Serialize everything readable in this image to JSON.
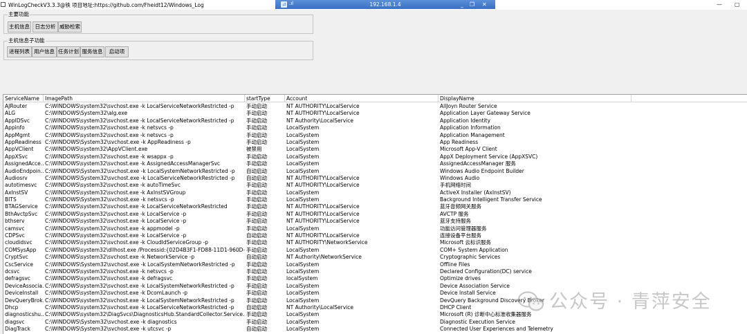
{
  "window": {
    "title": "WinLogCheckV3.3.3@铁 项目地址:https://github.com/Fheidt12/Windows_Log",
    "minimize": "—",
    "maximize": "▢"
  },
  "remote": {
    "pin": "⊿",
    "signal": ".ıl",
    "ip": "192.168.1.4",
    "minimize": "_",
    "restore": "❐",
    "close": "✕"
  },
  "main_functions": {
    "legend": "主要功能",
    "buttons": [
      "主机信息",
      "日志分析",
      "威胁检索"
    ]
  },
  "host_sub_functions": {
    "legend": "主机信息子功能",
    "buttons": [
      "进程列表",
      "用户信息",
      "任务计划",
      "服务信息",
      "启动项"
    ]
  },
  "table": {
    "columns": [
      "ServiceName",
      "ImagePath",
      "startType",
      "Account",
      "DisplayName"
    ],
    "rows": [
      [
        "AJRouter",
        "C:\\WINDOWS\\system32\\svchost.exe -k LocalServiceNetworkRestricted -p",
        "手动启动",
        "NT AUTHORITY\\LocalService",
        "AllJoyn Router Service"
      ],
      [
        "ALG",
        "C:\\WINDOWS\\System32\\alg.exe",
        "手动启动",
        "NT AUTHORITY\\LocalService",
        "Application Layer Gateway Service"
      ],
      [
        "AppIDSvc",
        "C:\\WINDOWS\\system32\\svchost.exe -k LocalServiceNetworkRestricted -p",
        "手动启动",
        "NT Authority\\LocalService",
        "Application Identity"
      ],
      [
        "Appinfo",
        "C:\\WINDOWS\\system32\\svchost.exe -k netsvcs -p",
        "手动启动",
        "LocalSystem",
        "Application Information"
      ],
      [
        "AppMgmt",
        "C:\\WINDOWS\\system32\\svchost.exe -k netsvcs -p",
        "手动启动",
        "LocalSystem",
        "Application Management"
      ],
      [
        "AppReadiness",
        "C:\\WINDOWS\\System32\\svchost.exe -k AppReadiness -p",
        "手动启动",
        "LocalSystem",
        "App Readiness"
      ],
      [
        "AppVClient",
        "C:\\WINDOWS\\system32\\AppVClient.exe",
        "被禁用",
        "LocalSystem",
        "Microsoft App-V Client"
      ],
      [
        "AppXSvc",
        "C:\\WINDOWS\\system32\\svchost.exe -k wsappx -p",
        "手动启动",
        "LocalSystem",
        "AppX Deployment Service (AppXSVC)"
      ],
      [
        "AssignedAcce...",
        "C:\\WINDOWS\\system32\\svchost.exe -k AssignedAccessManagerSvc",
        "手动启动",
        "LocalSystem",
        "AssignedAccessManager 服务"
      ],
      [
        "AudioEndpoin...",
        "C:\\WINDOWS\\System32\\svchost.exe -k LocalSystemNetworkRestricted -p",
        "自动启动",
        "LocalSystem",
        "Windows Audio Endpoint Builder"
      ],
      [
        "Audiosrv",
        "C:\\WINDOWS\\System32\\svchost.exe -k LocalServiceNetworkRestricted -p",
        "自动启动",
        "NT AUTHORITY\\LocalService",
        "Windows Audio"
      ],
      [
        "autotimesvc",
        "C:\\WINDOWS\\system32\\svchost.exe -k autoTimeSvc",
        "手动启动",
        "NT AUTHORITY\\LocalService",
        "手机网络时间"
      ],
      [
        "AxInstSV",
        "C:\\WINDOWS\\system32\\svchost.exe -k AxInstSVGroup",
        "手动启动",
        "LocalSystem",
        "ActiveX Installer (AxInstSV)"
      ],
      [
        "BITS",
        "C:\\WINDOWS\\System32\\svchost.exe -k netsvcs -p",
        "手动启动",
        "LocalSystem",
        "Background Intelligent Transfer Service"
      ],
      [
        "BTAGService",
        "C:\\WINDOWS\\system32\\svchost.exe -k LocalServiceNetworkRestricted",
        "手动启动",
        "NT AUTHORITY\\LocalService",
        "蓝牙音频网关服务"
      ],
      [
        "BthAvctpSvc",
        "C:\\WINDOWS\\system32\\svchost.exe -k LocalService -p",
        "手动启动",
        "NT AUTHORITY\\LocalService",
        "AVCTP 服务"
      ],
      [
        "bthserv",
        "C:\\WINDOWS\\system32\\svchost.exe -k LocalService -p",
        "手动启动",
        "NT AUTHORITY\\LocalService",
        "蓝牙支持服务"
      ],
      [
        "camsvc",
        "C:\\WINDOWS\\system32\\svchost.exe -k appmodel -p",
        "手动启动",
        "LocalSystem",
        "功能访问管理器服务"
      ],
      [
        "CDPSvc",
        "C:\\WINDOWS\\system32\\svchost.exe -k LocalService -p",
        "自动启动",
        "NT AUTHORITY\\LocalService",
        "连接设备平台服务"
      ],
      [
        "cloudidsvc",
        "C:\\WINDOWS\\system32\\svchost.exe -k CloudIdServiceGroup -p",
        "手动启动",
        "NT AUTHORITY\\NetworkService",
        "Microsoft 云标识服务"
      ],
      [
        "COMSysApp",
        "C:\\WINDOWS\\system32\\dllhost.exe /Processid:{02D4B3F1-FD88-11D1-960D-00805...",
        "手动启动",
        "LocalSystem",
        "COM+ System Application"
      ],
      [
        "CryptSvc",
        "C:\\WINDOWS\\system32\\svchost.exe -k NetworkService -p",
        "自动启动",
        "NT Authority\\NetworkService",
        "Cryptographic Services"
      ],
      [
        "CscService",
        "C:\\WINDOWS\\System32\\svchost.exe -k LocalSystemNetworkRestricted -p",
        "手动启动",
        "LocalSystem",
        "Offline Files"
      ],
      [
        "dcsvc",
        "C:\\WINDOWS\\system32\\svchost.exe -k netsvcs -p",
        "手动启动",
        "LocalSystem",
        "Declared Configuration(DC) service"
      ],
      [
        "defragsvc",
        "C:\\WINDOWS\\system32\\svchost.exe -k defragsvc",
        "手动启动",
        "localSystem",
        "Optimize drives"
      ],
      [
        "DeviceAssocia...",
        "C:\\WINDOWS\\system32\\svchost.exe -k LocalSystemNetworkRestricted -p",
        "手动启动",
        "LocalSystem",
        "Device Association Service"
      ],
      [
        "DeviceInstall",
        "C:\\WINDOWS\\system32\\svchost.exe -k DcomLaunch -p",
        "手动启动",
        "LocalSystem",
        "Device Install Service"
      ],
      [
        "DevQueryBrok...",
        "C:\\WINDOWS\\system32\\svchost.exe -k LocalSystemNetworkRestricted -p",
        "手动启动",
        "LocalSystem",
        "DevQuery Background Discovery Broker"
      ],
      [
        "Dhcp",
        "C:\\WINDOWS\\system32\\svchost.exe -k LocalServiceNetworkRestricted -p",
        "自动启动",
        "NT Authority\\LocalService",
        "DHCP Client"
      ],
      [
        "diagnosticshu...",
        "C:\\WINDOWS\\system32\\DiagSvcs\\DiagnosticsHub.StandardCollector.Service.exe",
        "手动启动",
        "LocalSystem",
        "Microsoft (R) 诊断中心标准收集器服务"
      ],
      [
        "diagsvc",
        "C:\\WINDOWS\\System32\\svchost.exe -k diagnostics",
        "手动启动",
        "LocalSystem",
        "Diagnostic Execution Service"
      ],
      [
        "DiagTrack",
        "C:\\WINDOWS\\System32\\svchost.exe -k utcsvc -p",
        "自动启动",
        "LocalSystem",
        "Connected User Experiences and Telemetry"
      ]
    ]
  },
  "watermark": {
    "text": "公众号 · 青萍安全"
  }
}
